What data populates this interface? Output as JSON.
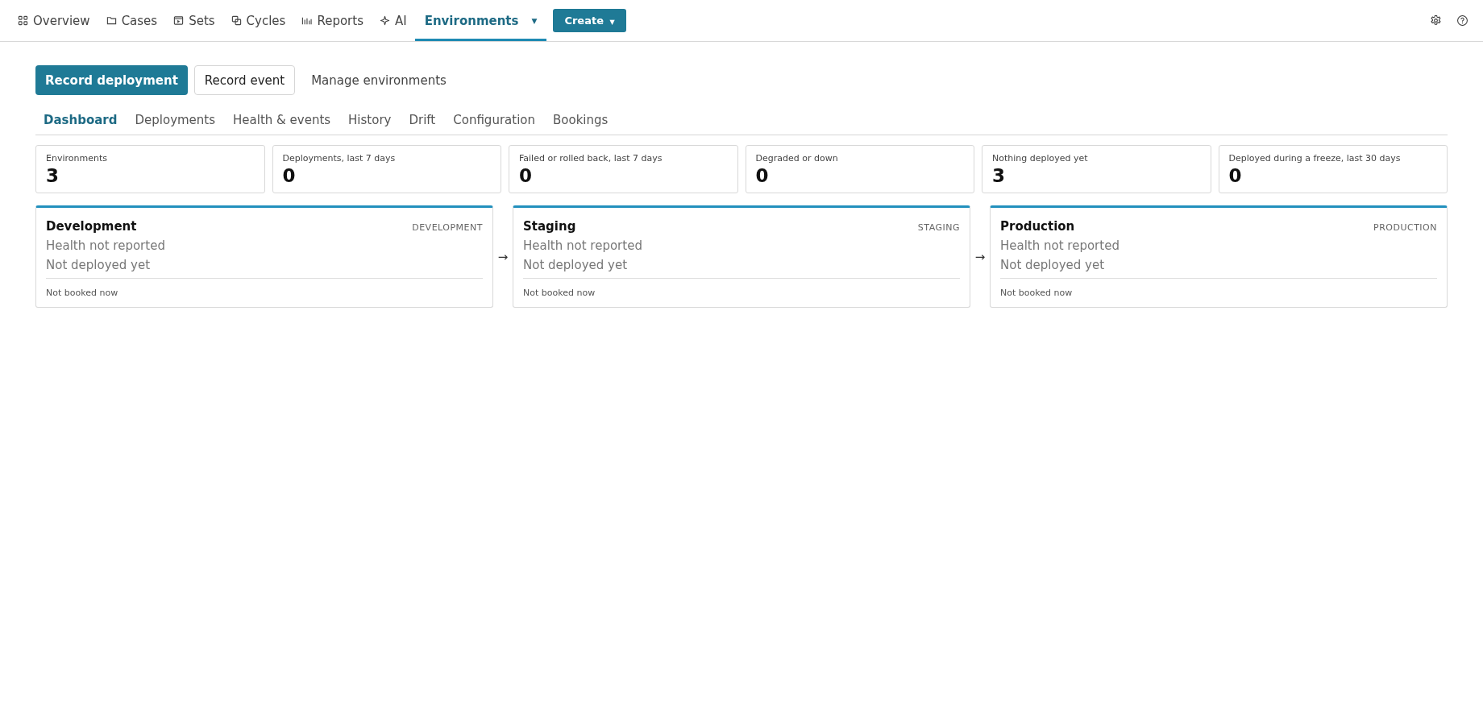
{
  "nav": {
    "items": [
      {
        "label": "Overview",
        "kind": "grid",
        "selected": false
      },
      {
        "label": "Cases",
        "kind": "folder",
        "selected": false
      },
      {
        "label": "Sets",
        "kind": "player",
        "selected": false
      },
      {
        "label": "Cycles",
        "kind": "copies",
        "selected": false
      },
      {
        "label": "Reports",
        "kind": "bars",
        "selected": false
      },
      {
        "label": "AI",
        "kind": "sparkle",
        "selected": false
      },
      {
        "label": "Environments",
        "kind": "dropdown",
        "caret": "▼",
        "selected": true
      }
    ],
    "create": {
      "label": "Create",
      "caret": "▼"
    }
  },
  "actions": [
    {
      "label": "Record deployment",
      "kind": "primary"
    },
    {
      "label": "Record event",
      "kind": "secondary"
    },
    {
      "label": "Manage environments",
      "kind": "link"
    }
  ],
  "tabs": [
    {
      "label": "Dashboard",
      "selected": true
    },
    {
      "label": "Deployments",
      "selected": false
    },
    {
      "label": "Health & events",
      "selected": false
    },
    {
      "label": "History",
      "selected": false
    },
    {
      "label": "Drift",
      "selected": false
    },
    {
      "label": "Configuration",
      "selected": false
    },
    {
      "label": "Bookings",
      "selected": false
    }
  ],
  "stats": [
    {
      "label": "Environments",
      "value": "3"
    },
    {
      "label": "Deployments, last 7 days",
      "value": "0"
    },
    {
      "label": "Failed or rolled back, last 7 days",
      "value": "0"
    },
    {
      "label": "Degraded or down",
      "value": "0"
    },
    {
      "label": "Nothing deployed yet",
      "value": "3"
    },
    {
      "label": "Deployed during a freeze, last 30 days",
      "value": "0"
    }
  ],
  "environments": [
    {
      "name": "Development",
      "tag": "DEVELOPMENT",
      "health": "Health not reported",
      "deployment": "Not deployed yet",
      "booking": "Not booked now"
    },
    {
      "connector": "→",
      "name": "Staging",
      "tag": "STAGING",
      "health": "Health not reported",
      "deployment": "Not deployed yet",
      "booking": "Not booked now"
    },
    {
      "connector": "→",
      "name": "Production",
      "tag": "PRODUCTION",
      "health": "Health not reported",
      "deployment": "Not deployed yet",
      "booking": "Not booked now"
    }
  ]
}
